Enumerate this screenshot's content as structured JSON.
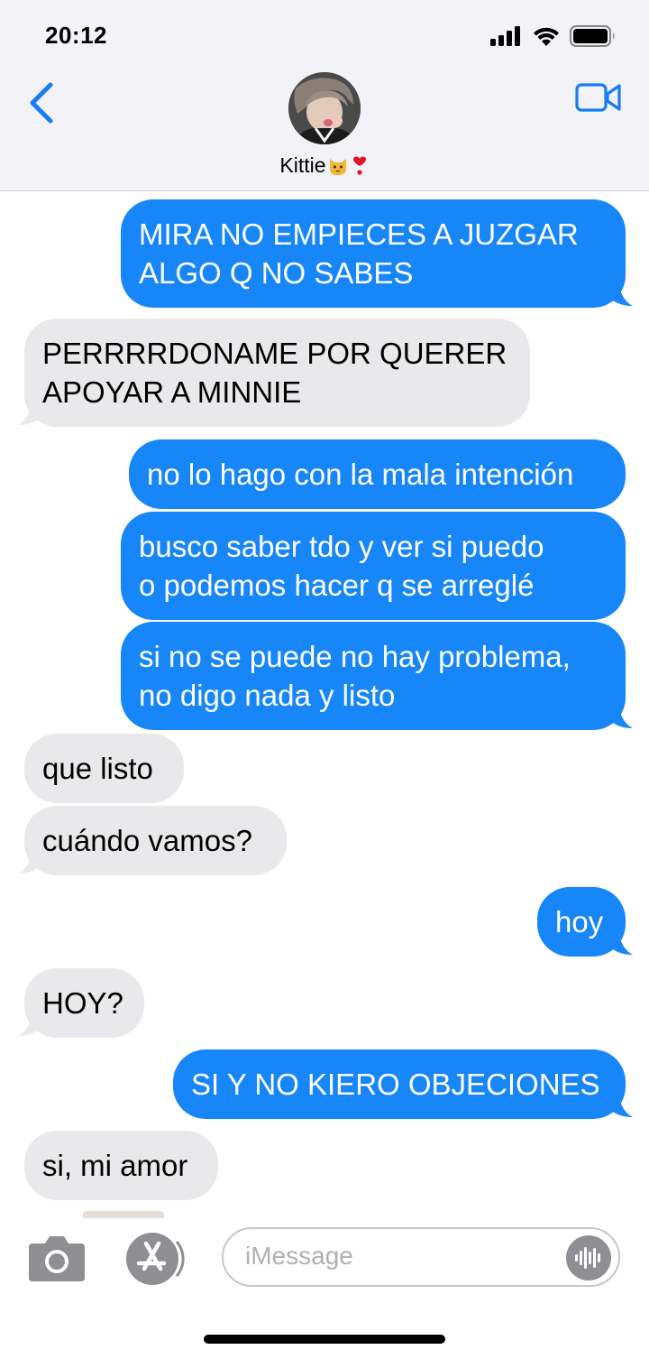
{
  "status": {
    "time": "20:12"
  },
  "header": {
    "contact_name": "Kittie",
    "contact_emojis": "🐱❣️"
  },
  "messages": [
    {
      "dir": "out",
      "lines": [
        "MIRA NO EMPIECES A JUZGAR",
        "ALGO Q NO SABES"
      ]
    },
    {
      "dir": "in",
      "lines": [
        "PERRRRDONAME POR QUERER",
        "APOYAR A MINNIE"
      ]
    },
    {
      "dir": "out",
      "lines": [
        "no lo hago con la mala intención"
      ]
    },
    {
      "dir": "out",
      "lines": [
        "busco saber tdo y ver si puedo",
        "o podemos hacer q se arreglé"
      ]
    },
    {
      "dir": "out",
      "lines": [
        "si no se puede no hay problema,",
        "no digo nada y listo"
      ]
    },
    {
      "dir": "in",
      "lines": [
        "que listo"
      ]
    },
    {
      "dir": "in",
      "lines": [
        "cuándo vamos?"
      ]
    },
    {
      "dir": "out",
      "lines": [
        "hoy"
      ]
    },
    {
      "dir": "in",
      "lines": [
        "HOY?"
      ]
    },
    {
      "dir": "out",
      "lines": [
        "SI Y NO KIERO OBJECIONES"
      ]
    },
    {
      "dir": "in",
      "lines": [
        "si, mi amor"
      ]
    }
  ],
  "composer": {
    "placeholder": "iMessage"
  },
  "colors": {
    "outgoing": "#1786f8",
    "incoming": "#e9e9eb",
    "accent": "#1a7cf5",
    "header_bg": "#f2f2f7"
  }
}
